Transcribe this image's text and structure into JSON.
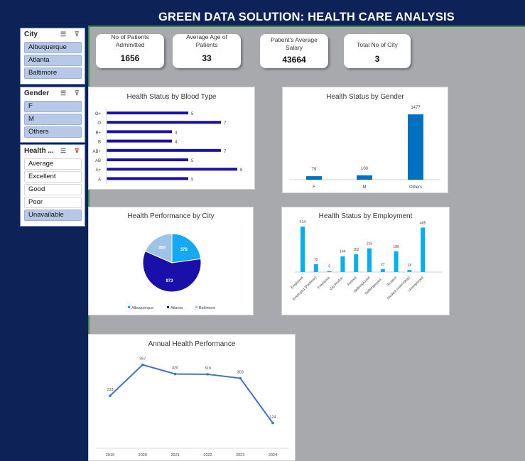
{
  "title": "GREEN DATA SOLUTION: HEALTH CARE ANALYSIS",
  "colors": {
    "navy": "#0d2256",
    "bar": "#1a0fa8",
    "blue": "#0070c0",
    "cyan": "#00b0f0",
    "pie_atlanta": "#1a0fa8",
    "pie_albuquerque": "#14a9f2",
    "pie_baltimore": "#9dc3e6"
  },
  "slicers": {
    "city": {
      "label": "City",
      "items": [
        "Albuquerque",
        "Atlanta",
        "Baltimore"
      ]
    },
    "gender": {
      "label": "Gender",
      "items": [
        "F",
        "M",
        "Others"
      ]
    },
    "health": {
      "label": "Health ...",
      "items": [
        "Average",
        "Excellent",
        "Good",
        "Poor",
        "Unavailable"
      ]
    }
  },
  "kpis": [
    {
      "label": "No of Patients Admmitted",
      "value": "1656"
    },
    {
      "label": "Average Age of Patients",
      "value": "33"
    },
    {
      "label": "Patient's Average Salary",
      "value": "43664"
    },
    {
      "label": "Total No of City",
      "value": "3"
    }
  ],
  "chart_data": [
    {
      "type": "bar",
      "title": "Health Status by Blood Type",
      "orientation": "horizontal",
      "categories": [
        "O+",
        "O",
        "B+",
        "B",
        "AB+",
        "AB",
        "A+",
        "A"
      ],
      "values": [
        5,
        7,
        4,
        4,
        7,
        5,
        8,
        5
      ]
    },
    {
      "type": "bar",
      "title": "Health Status by Gender",
      "categories": [
        "F",
        "M",
        "Others"
      ],
      "values": [
        79,
        100,
        1477
      ]
    },
    {
      "type": "pie",
      "title": "Health Performance by City",
      "categories": [
        "Albuquerque",
        "Atlanta",
        "Baltimore"
      ],
      "values": [
        378,
        973,
        305
      ],
      "legend": "bottom"
    },
    {
      "type": "bar",
      "title": "Health Status by Employment",
      "categories": [
        "Employed",
        "Employed (Parttime)",
        "Freelance",
        "Gig Worker",
        "Retired",
        "Selfemployed",
        "Selfemployed...",
        "Student",
        "Student (Internship)",
        "Unemployed"
      ],
      "values": [
        414,
        72,
        9,
        144,
        162,
        216,
        27,
        189,
        18,
        405
      ]
    },
    {
      "type": "line",
      "title": "Annual Health Performance",
      "x": [
        "2019",
        "2020",
        "2021",
        "2022",
        "2023",
        "2024"
      ],
      "values": [
        233,
        357,
        320,
        319,
        303,
        124
      ]
    }
  ]
}
